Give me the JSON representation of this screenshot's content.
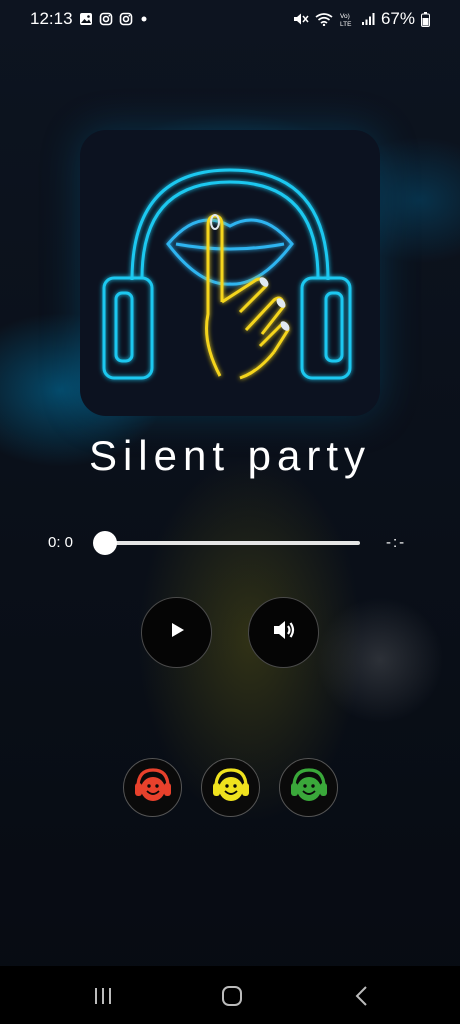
{
  "status_bar": {
    "time": "12:13",
    "battery": "67%",
    "left_icons": [
      "gallery-icon",
      "instagram-icon",
      "instagram-icon",
      "dot-icon"
    ],
    "right_icons": [
      "mute-icon",
      "wifi-icon",
      "volte-icon",
      "signal-icon",
      "battery-icon"
    ]
  },
  "player": {
    "title": "Silent party",
    "current_time": "0: 0",
    "total_time": "-:-",
    "progress": 0,
    "artwork_icons": [
      "headphones-icon",
      "lips-icon",
      "shush-finger-icon"
    ]
  },
  "controls": {
    "play_icon": "play-icon",
    "volume_icon": "volume-icon"
  },
  "channels": [
    {
      "icon": "headphones-smiley-icon",
      "color": "#e8412c"
    },
    {
      "icon": "headphones-smiley-icon",
      "color": "#efe21e"
    },
    {
      "icon": "headphones-smiley-icon",
      "color": "#3aa83a"
    }
  ],
  "nav_bar": [
    "recents-icon",
    "home-icon",
    "back-icon"
  ]
}
